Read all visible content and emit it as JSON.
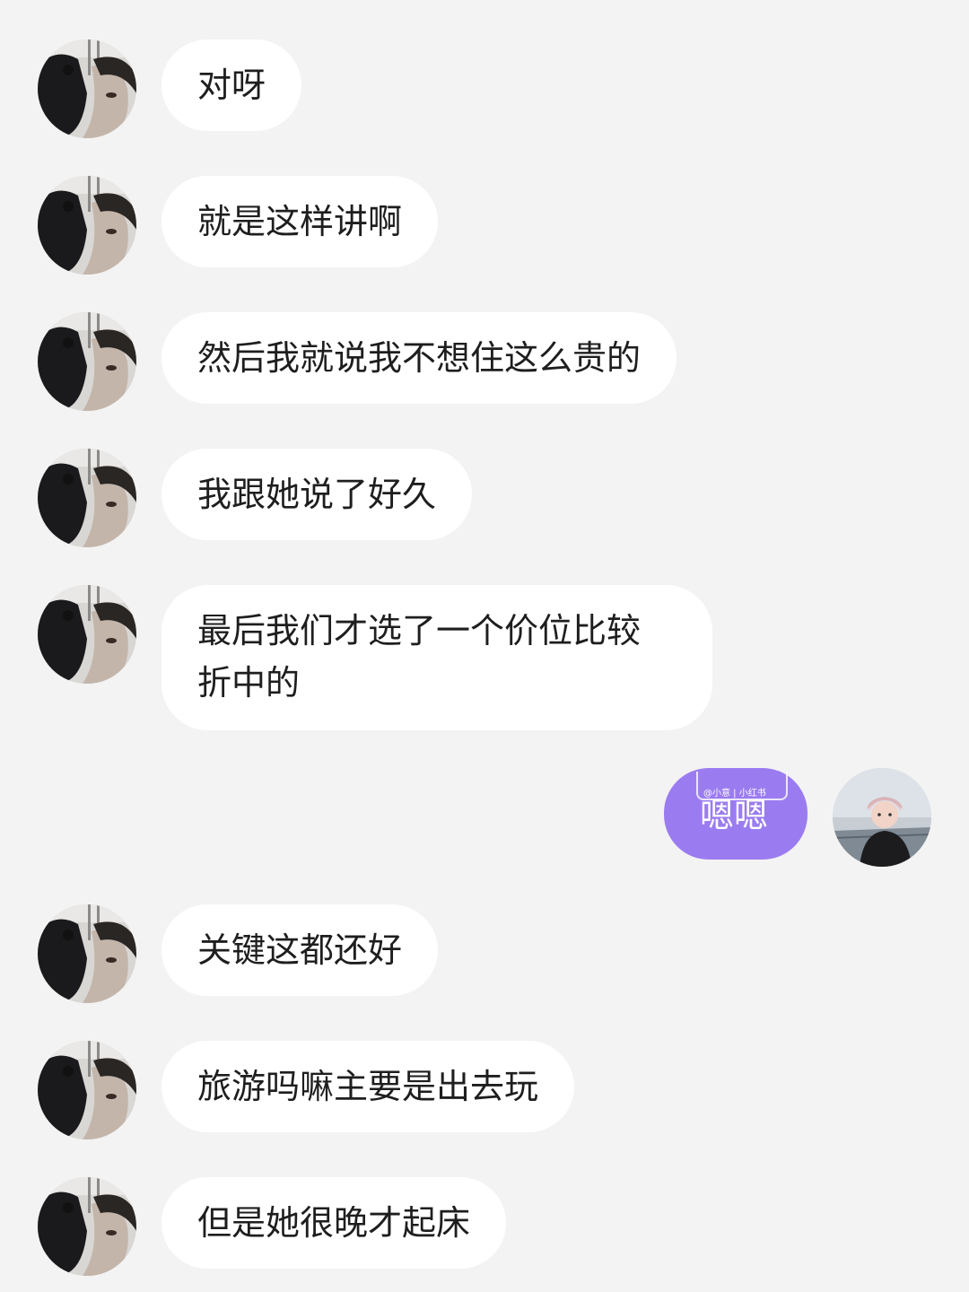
{
  "messages": [
    {
      "side": "left",
      "text": "对呀"
    },
    {
      "side": "left",
      "text": "就是这样讲啊"
    },
    {
      "side": "left",
      "text": "然后我就说我不想住这么贵的"
    },
    {
      "side": "left",
      "text": "我跟她说了好久"
    },
    {
      "side": "left",
      "text_line1": "最后我们才选了一个价位比较",
      "text_line2": "折中的"
    },
    {
      "side": "right",
      "text": "嗯嗯",
      "watermark": "@小意 | 小红书"
    },
    {
      "side": "left",
      "text": "关键这都还好"
    },
    {
      "side": "left",
      "text": "旅游吗嘛主要是出去玩"
    },
    {
      "side": "left",
      "text": "但是她很晚才起床"
    }
  ],
  "colors": {
    "background": "#f3f3f3",
    "incoming_bubble": "#ffffff",
    "outgoing_bubble": "#9b7cf0",
    "text": "#1e1e1e"
  },
  "icons": {
    "contact_avatar": "contact-avatar-icon",
    "self_avatar": "self-avatar-icon"
  }
}
